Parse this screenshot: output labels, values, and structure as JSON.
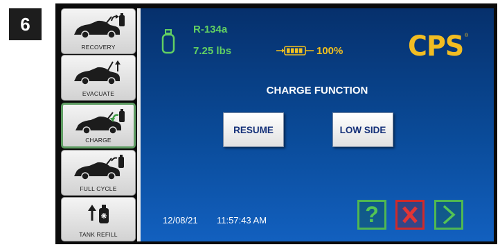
{
  "step_number": "6",
  "sidebar": {
    "items": [
      {
        "label": "RECOVERY",
        "icon": "car-recovery-icon"
      },
      {
        "label": "EVACUATE",
        "icon": "car-evacuate-icon"
      },
      {
        "label": "CHARGE",
        "icon": "car-charge-icon",
        "active": true
      },
      {
        "label": "FULL CYCLE",
        "icon": "car-full-cycle-icon"
      },
      {
        "label": "TANK REFILL",
        "icon": "tank-refill-icon"
      }
    ]
  },
  "status": {
    "refrigerant": "R-134a",
    "weight": "7.25 lbs",
    "battery": "100%"
  },
  "brand": {
    "logo": "CPS",
    "mark": "®"
  },
  "main": {
    "title": "CHARGE FUNCTION",
    "resume_label": "RESUME",
    "low_side_label": "LOW SIDE"
  },
  "footer": {
    "date": "12/08/21",
    "time": "11:57:43 AM"
  },
  "controls": {
    "help_label": "?"
  },
  "colors": {
    "screen_top": "#06306c",
    "screen_bottom": "#1260bf",
    "status_green": "#62d062",
    "battery_yellow": "#f2c01e",
    "logo_yellow": "#f2bd22",
    "cancel_red": "#d02a2a",
    "active_border": "#5f9d63"
  }
}
